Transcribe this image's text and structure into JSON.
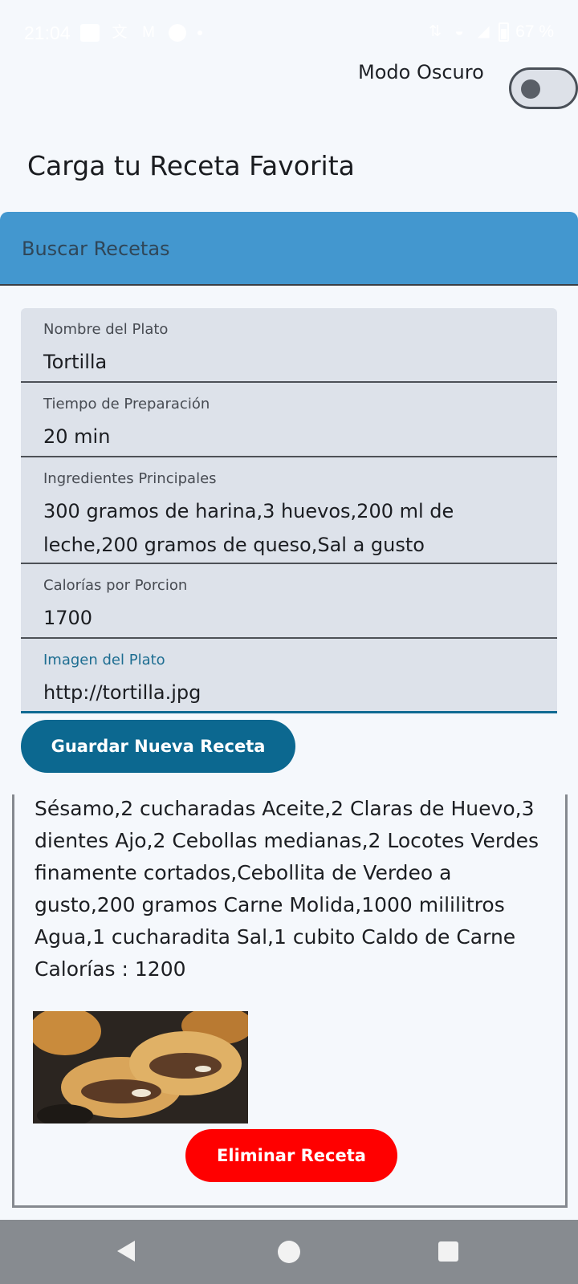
{
  "status_bar": {
    "time": "21:04",
    "battery": "67 %"
  },
  "dark_mode": {
    "label": "Modo Oscuro",
    "enabled": false
  },
  "page": {
    "title": "Carga tu Receta Favorita"
  },
  "search": {
    "label": "Buscar Recetas"
  },
  "form": {
    "fields": [
      {
        "label": "Nombre del Plato",
        "value": "Tortilla"
      },
      {
        "label": "Tiempo de Preparación",
        "value": "20 min"
      },
      {
        "label": "Ingredientes Principales",
        "value": "300 gramos de harina,3 huevos,200 ml de leche,200 gramos de queso,Sal a gusto"
      },
      {
        "label": "Calorías por Porcion",
        "value": "1700"
      },
      {
        "label": "Imagen del Plato",
        "value": "http://tortilla.jpg"
      }
    ],
    "save_label": "Guardar Nueva Receta"
  },
  "recipe_card": {
    "ingredients_text": "Sésamo,2 cucharadas Aceite,2 Claras de Huevo,3 dientes Ajo,2 Cebollas medianas,2 Locotes Verdes finamente cortados,Cebollita de Verdeo a gusto,200 gramos Carne Molida,1000 mililitros Agua,1 cucharadita Sal,1 cubito Caldo de Carne",
    "calories_text": "Calorías : 1200",
    "delete_label": "Eliminar Receta"
  },
  "colors": {
    "search_bar": "#4397cf",
    "primary_button": "#0c6890",
    "delete_button": "#ff0000",
    "field_background": "#dde2ea"
  }
}
